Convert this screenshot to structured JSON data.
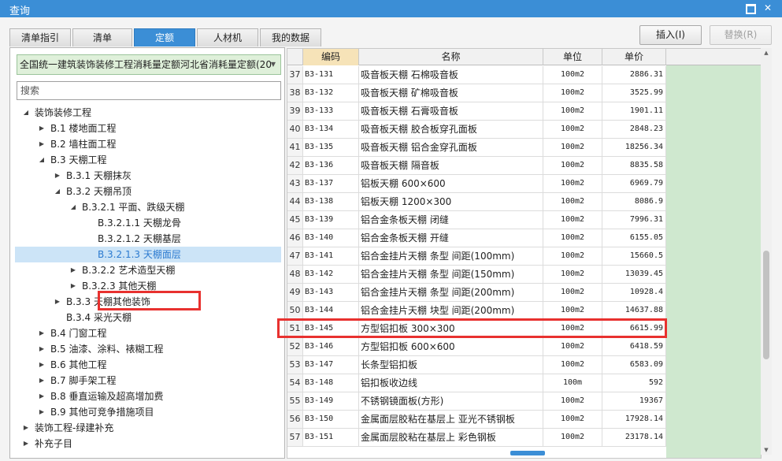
{
  "window": {
    "title": "查询"
  },
  "tabs": [
    {
      "label": "清单指引",
      "active": false
    },
    {
      "label": "清单",
      "active": false
    },
    {
      "label": "定额",
      "active": true
    },
    {
      "label": "人材机",
      "active": false
    },
    {
      "label": "我的数据",
      "active": false
    }
  ],
  "buttons": {
    "insert": "插入(I)",
    "replace": "替换(R)"
  },
  "library": {
    "selected": "全国统一建筑装饰装修工程消耗量定额河北省消耗量定额(20"
  },
  "search": {
    "placeholder": "搜索",
    "value": ""
  },
  "tree": [
    {
      "label": "装饰装修工程",
      "expanded": true
    },
    {
      "label": "B.1 楼地面工程",
      "expanded": false
    },
    {
      "label": "B.2 墙柱面工程",
      "expanded": false
    },
    {
      "label": "B.3 天棚工程",
      "expanded": true
    },
    {
      "label": "B.3.1 天棚抹灰",
      "expanded": false
    },
    {
      "label": "B.3.2 天棚吊顶",
      "expanded": true
    },
    {
      "label": "B.3.2.1 平面、跌级天棚",
      "expanded": true
    },
    {
      "label": "B.3.2.1.1 天棚龙骨"
    },
    {
      "label": "B.3.2.1.2 天棚基层"
    },
    {
      "label": "B.3.2.1.3 天棚面层",
      "selected": true
    },
    {
      "label": "B.3.2.2 艺术造型天棚",
      "expanded": false
    },
    {
      "label": "B.3.2.3 其他天棚",
      "expanded": false
    },
    {
      "label": "B.3.3 天棚其他装饰",
      "expanded": false
    },
    {
      "label": "B.3.4 采光天棚"
    },
    {
      "label": "B.4 门窗工程",
      "expanded": false
    },
    {
      "label": "B.5 油漆、涂料、裱糊工程",
      "expanded": false
    },
    {
      "label": "B.6 其他工程",
      "expanded": false
    },
    {
      "label": "B.7 脚手架工程",
      "expanded": false
    },
    {
      "label": "B.8 垂直运输及超高增加费",
      "expanded": false
    },
    {
      "label": "B.9 其他可竞争措施项目",
      "expanded": false
    },
    {
      "label": "装饰工程-绿建补充",
      "expanded": false
    },
    {
      "label": "补充子目",
      "expanded": false
    }
  ],
  "grid": {
    "columns": {
      "code": "编码",
      "name": "名称",
      "unit": "单位",
      "price": "单价"
    },
    "rows": [
      {
        "num": "37",
        "code": "B3-131",
        "name": "吸音板天棚 石棉吸音板",
        "unit": "100m2",
        "price": "2886.31"
      },
      {
        "num": "38",
        "code": "B3-132",
        "name": "吸音板天棚 矿棉吸音板",
        "unit": "100m2",
        "price": "3525.99"
      },
      {
        "num": "39",
        "code": "B3-133",
        "name": "吸音板天棚 石膏吸音板",
        "unit": "100m2",
        "price": "1901.11"
      },
      {
        "num": "40",
        "code": "B3-134",
        "name": "吸音板天棚 胶合板穿孔面板",
        "unit": "100m2",
        "price": "2848.23"
      },
      {
        "num": "41",
        "code": "B3-135",
        "name": "吸音板天棚 铝合金穿孔面板",
        "unit": "100m2",
        "price": "18256.34"
      },
      {
        "num": "42",
        "code": "B3-136",
        "name": "吸音板天棚 隔音板",
        "unit": "100m2",
        "price": "8835.58"
      },
      {
        "num": "43",
        "code": "B3-137",
        "name": "铝板天棚 600×600",
        "unit": "100m2",
        "price": "6969.79"
      },
      {
        "num": "44",
        "code": "B3-138",
        "name": "铝板天棚 1200×300",
        "unit": "100m2",
        "price": "8086.9"
      },
      {
        "num": "45",
        "code": "B3-139",
        "name": "铝合金条板天棚 闭缝",
        "unit": "100m2",
        "price": "7996.31"
      },
      {
        "num": "46",
        "code": "B3-140",
        "name": "铝合金条板天棚 开缝",
        "unit": "100m2",
        "price": "6155.05"
      },
      {
        "num": "47",
        "code": "B3-141",
        "name": "铝合金挂片天棚 条型 间距(100mm)",
        "unit": "100m2",
        "price": "15660.5"
      },
      {
        "num": "48",
        "code": "B3-142",
        "name": "铝合金挂片天棚 条型 间距(150mm)",
        "unit": "100m2",
        "price": "13039.45"
      },
      {
        "num": "49",
        "code": "B3-143",
        "name": "铝合金挂片天棚 条型 间距(200mm)",
        "unit": "100m2",
        "price": "10928.4"
      },
      {
        "num": "50",
        "code": "B3-144",
        "name": "铝合金挂片天棚 块型 间距(200mm)",
        "unit": "100m2",
        "price": "14637.88"
      },
      {
        "num": "51",
        "code": "B3-145",
        "name": "方型铝扣板 300×300",
        "unit": "100m2",
        "price": "6615.99",
        "highlighted": true
      },
      {
        "num": "52",
        "code": "B3-146",
        "name": "方型铝扣板 600×600",
        "unit": "100m2",
        "price": "6418.59"
      },
      {
        "num": "53",
        "code": "B3-147",
        "name": "长条型铝扣板",
        "unit": "100m2",
        "price": "6583.09"
      },
      {
        "num": "54",
        "code": "B3-148",
        "name": "铝扣板收边线",
        "unit": "100m",
        "price": "592"
      },
      {
        "num": "55",
        "code": "B3-149",
        "name": "不锈钢镜面板(方形)",
        "unit": "100m2",
        "price": "19367"
      },
      {
        "num": "56",
        "code": "B3-150",
        "name": "金属面层胶粘在基层上 亚光不锈钢板",
        "unit": "100m2",
        "price": "17928.14"
      },
      {
        "num": "57",
        "code": "B3-151",
        "name": "金属面层胶粘在基层上 彩色钢板",
        "unit": "100m2",
        "price": "23178.14"
      }
    ]
  }
}
